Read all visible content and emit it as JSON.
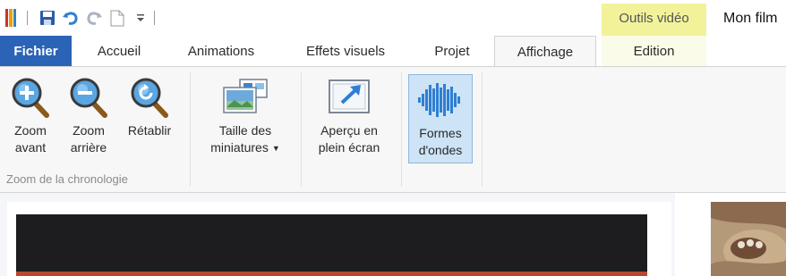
{
  "window": {
    "title": "Mon film"
  },
  "quick_access": {
    "icons": [
      "app-icon",
      "save-icon",
      "undo-icon",
      "redo-icon",
      "new-document-icon",
      "customize-toolbar-icon"
    ]
  },
  "contextual_group": {
    "label": "Outils vidéo",
    "color": "#f2f29a"
  },
  "tabs": [
    {
      "label": "Fichier",
      "state": "file"
    },
    {
      "label": "Accueil"
    },
    {
      "label": "Animations"
    },
    {
      "label": "Effets visuels"
    },
    {
      "label": "Projet"
    },
    {
      "label": "Affichage",
      "state": "active"
    },
    {
      "label": "Edition",
      "state": "contextual"
    }
  ],
  "ribbon": {
    "zoom_group": {
      "label": "Zoom de la chronologie",
      "buttons": [
        {
          "line1": "Zoom",
          "line2": "avant",
          "icon": "zoom-in-icon"
        },
        {
          "line1": "Zoom",
          "line2": "arrière",
          "icon": "zoom-out-icon"
        },
        {
          "line1": "Rétablir",
          "line2": "",
          "icon": "zoom-reset-icon"
        }
      ]
    },
    "thumbnail_size": {
      "line1": "Taille des",
      "line2": "miniatures",
      "icon": "thumbnail-size-icon",
      "dropdown": true
    },
    "fullscreen_preview": {
      "line1": "Aperçu en",
      "line2": "plein écran",
      "icon": "fullscreen-preview-icon"
    },
    "waveforms": {
      "line1": "Formes",
      "line2": "d'ondes",
      "icon": "waveform-icon",
      "selected": true
    }
  },
  "colors": {
    "file_tab": "#2b63b6",
    "ribbon_bg": "#f7f7f7",
    "selected_bg": "#cde3f6",
    "accent_blue": "#2f7fd1"
  }
}
